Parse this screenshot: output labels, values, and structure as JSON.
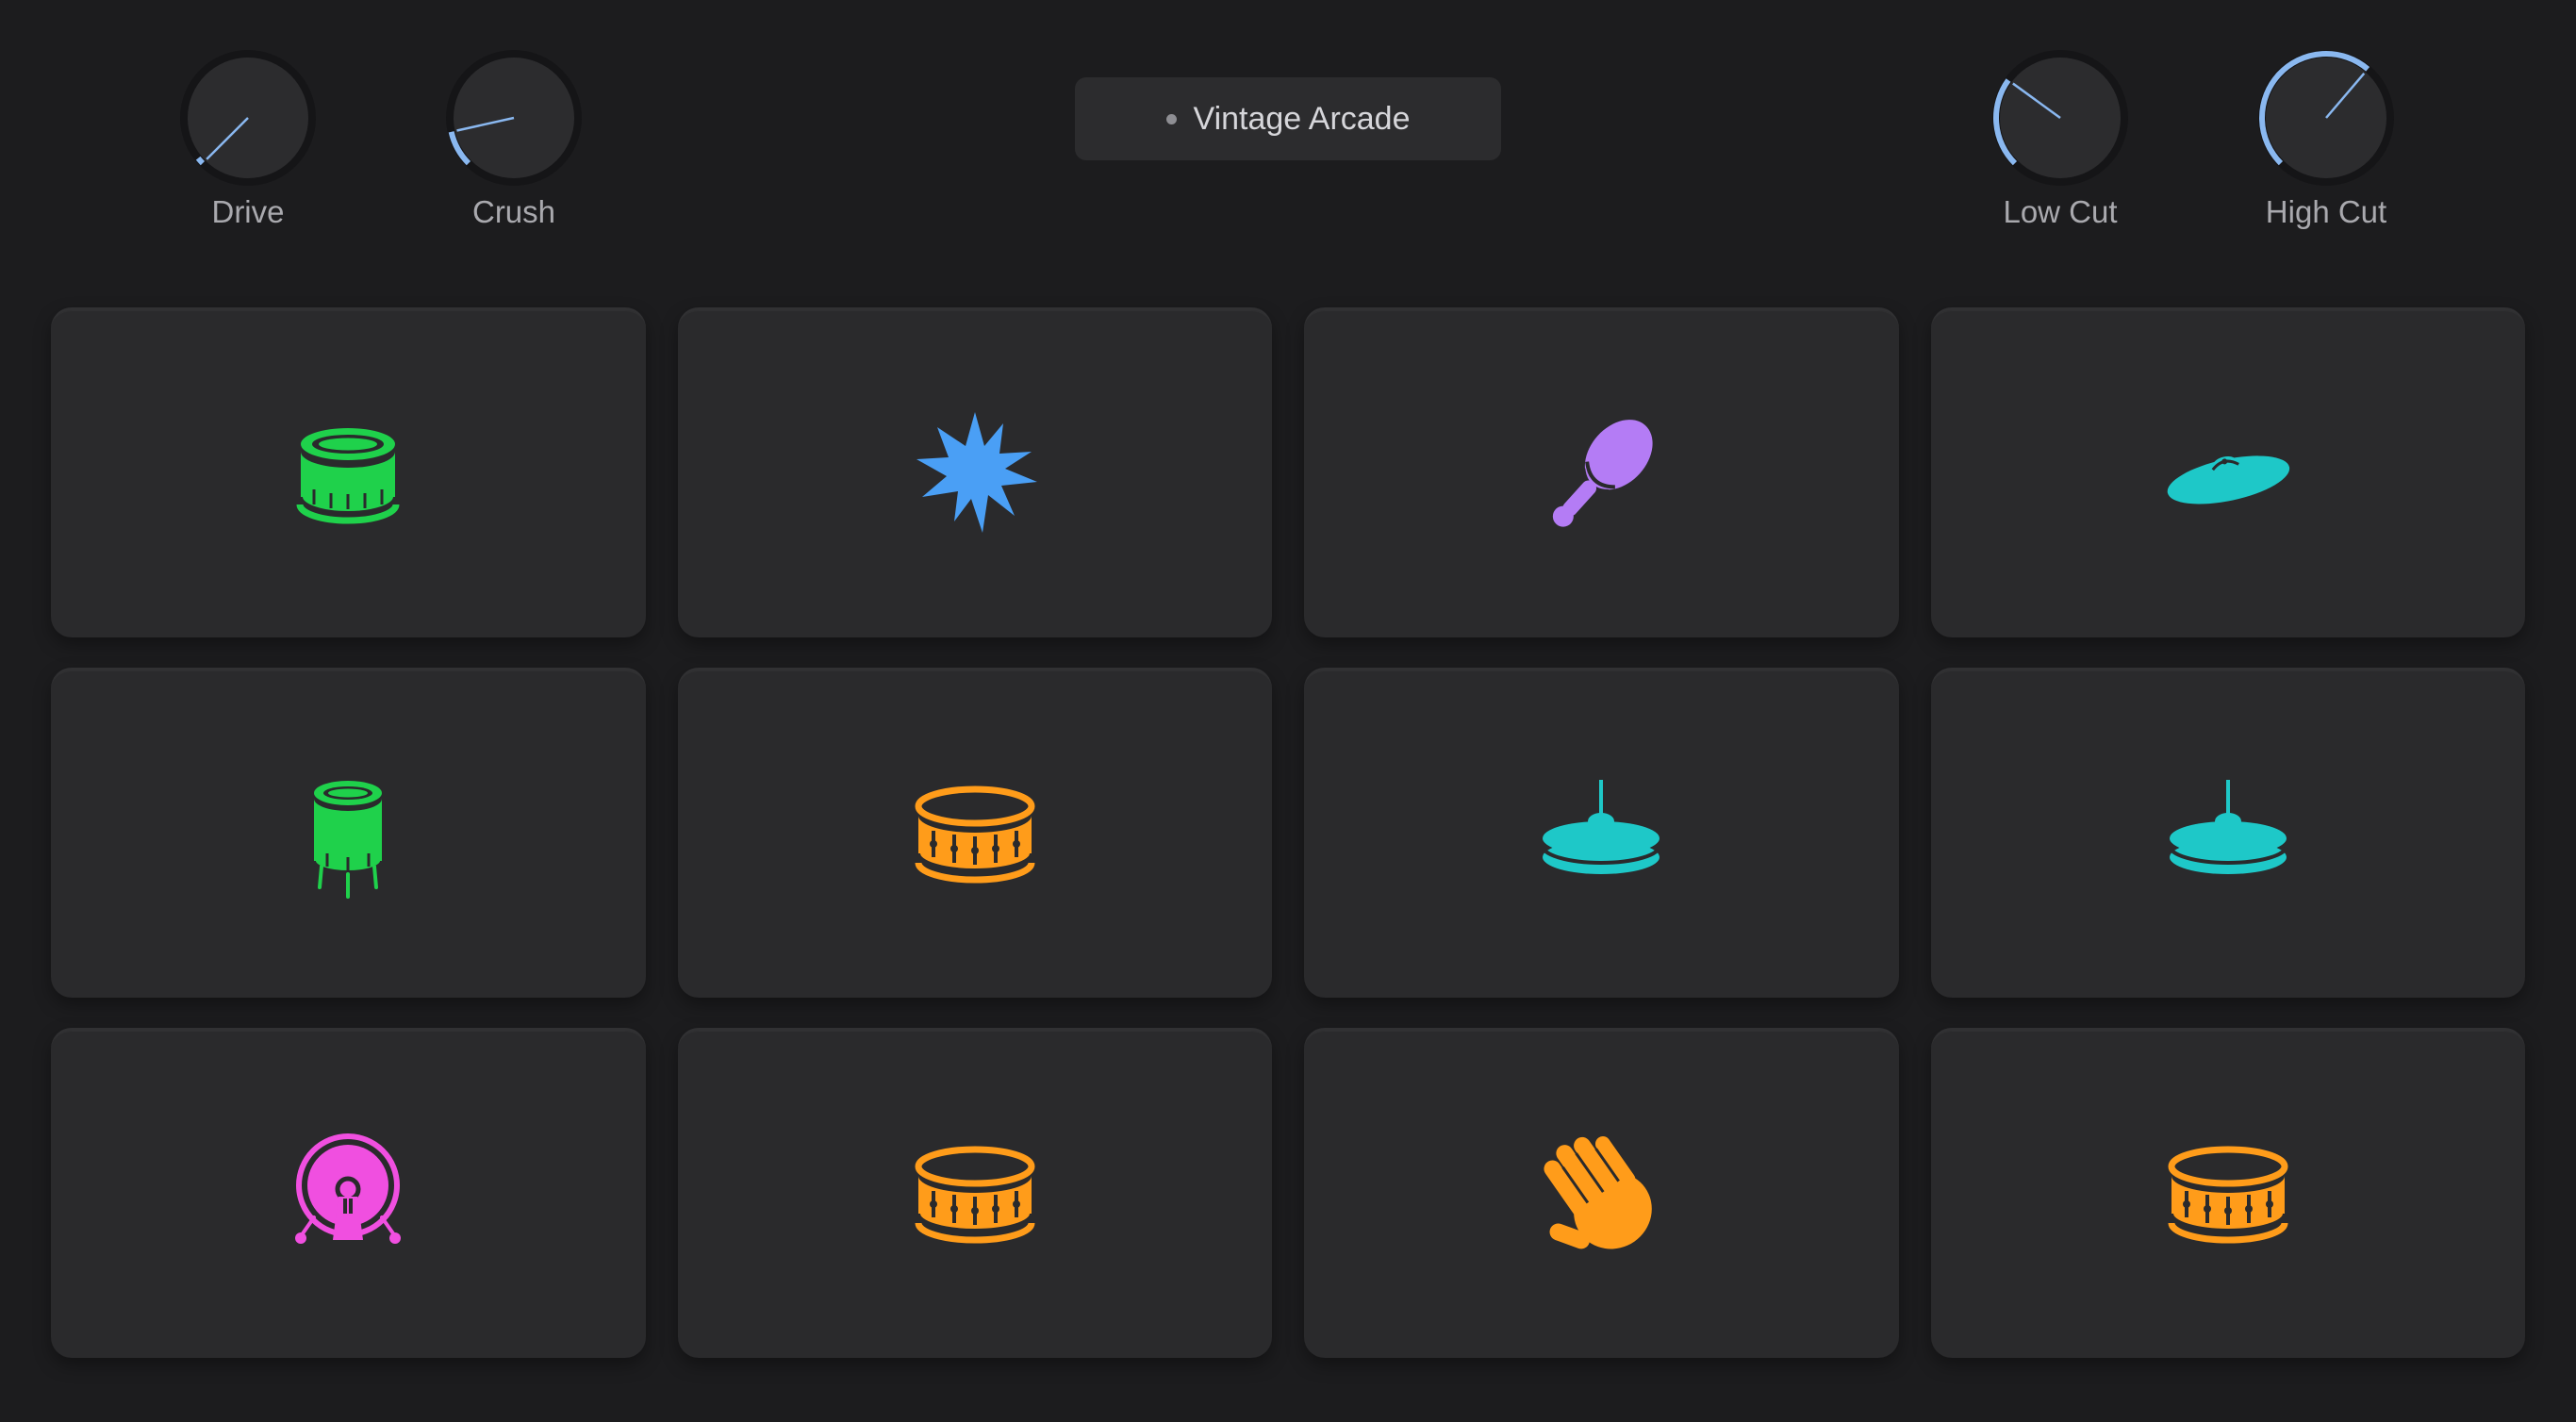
{
  "knobs": [
    {
      "id": "drive",
      "label": "Drive",
      "value": 0.0
    },
    {
      "id": "crush",
      "label": "Crush",
      "value": 0.12
    },
    {
      "id": "low_cut",
      "label": "Low Cut",
      "value": 0.3
    },
    {
      "id": "high_cut",
      "label": "High Cut",
      "value": 0.65
    }
  ],
  "preset": {
    "name": "Vintage Arcade"
  },
  "colors": {
    "background": "#1c1c1e",
    "pad": "#2a2a2c",
    "accent": "#8ab8f0",
    "green": "#1fd14b",
    "blue": "#4a9ff5",
    "purple": "#b47cf5",
    "cyan": "#1ec8c8",
    "orange": "#ff9c1a",
    "magenta": "#f04fe0"
  },
  "pads": [
    {
      "icon": "floor-tom-icon",
      "color": "#1fd14b"
    },
    {
      "icon": "burst-icon",
      "color": "#4a9ff5"
    },
    {
      "icon": "maraca-icon",
      "color": "#b47cf5"
    },
    {
      "icon": "cymbal-icon",
      "color": "#1ec8c8"
    },
    {
      "icon": "tom-with-legs-icon",
      "color": "#1fd14b"
    },
    {
      "icon": "snare-drum-icon",
      "color": "#ff9c1a"
    },
    {
      "icon": "hi-hat-icon",
      "color": "#1ec8c8"
    },
    {
      "icon": "hi-hat-icon",
      "color": "#1ec8c8"
    },
    {
      "icon": "kick-drum-icon",
      "color": "#f04fe0"
    },
    {
      "icon": "snare-drum-icon",
      "color": "#ff9c1a"
    },
    {
      "icon": "hand-clap-icon",
      "color": "#ff9c1a"
    },
    {
      "icon": "snare-drum-icon",
      "color": "#ff9c1a"
    }
  ]
}
